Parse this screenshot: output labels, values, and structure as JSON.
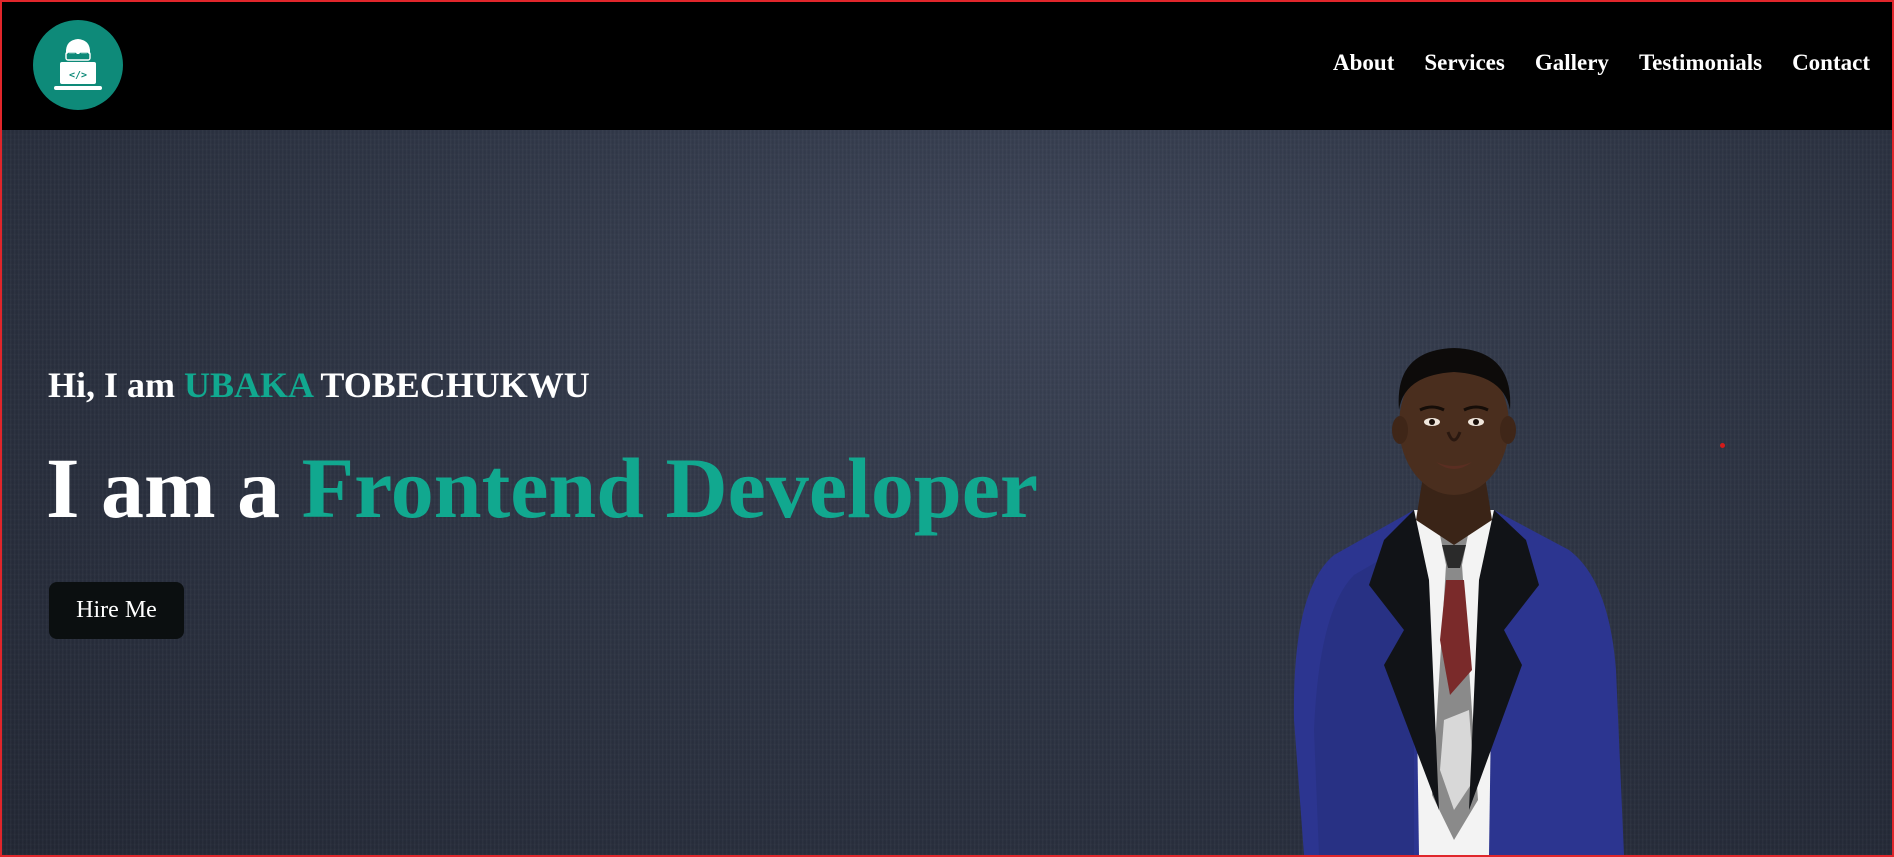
{
  "brand": {
    "logo_icon": "developer-laptop-icon",
    "accent": "#11a88f",
    "logo_bg": "#0e8a79"
  },
  "nav": {
    "items": [
      "About",
      "Services",
      "Gallery",
      "Testimonials",
      "Contact"
    ]
  },
  "hero": {
    "greeting_prefix": "Hi, I am ",
    "first_name": "UBAKA",
    "last_name": " TOBECHUKWU",
    "headline_prefix": "I am a ",
    "headline_role": "Frontend Developer",
    "cta_label": "Hire Me",
    "portrait_icon": "person-portrait"
  },
  "colors": {
    "header_bg": "#000000",
    "hero_bg": "#2e3444",
    "text": "#ffffff",
    "button_bg": "#0b0f10",
    "frame_border": "#e0262b"
  }
}
